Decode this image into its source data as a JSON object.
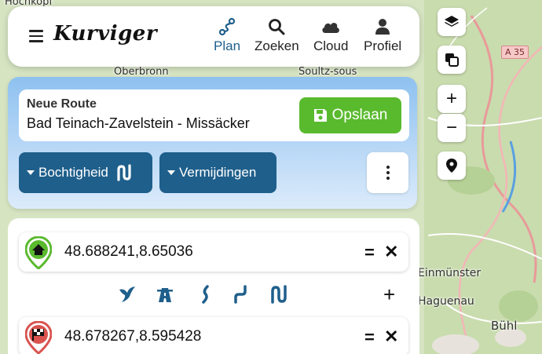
{
  "app": {
    "logo_text": "Kurviger"
  },
  "nav": [
    {
      "label": "Plan",
      "icon": "route-icon",
      "active": true
    },
    {
      "label": "Zoeken",
      "icon": "search-icon",
      "active": false
    },
    {
      "label": "Cloud",
      "icon": "cloud-icon",
      "active": false
    },
    {
      "label": "Profiel",
      "icon": "user-icon",
      "active": false
    }
  ],
  "route": {
    "caption": "Neue Route",
    "name": "Bad Teinach-Zavelstein - Missäcker",
    "save_label": "Opslaan"
  },
  "options": {
    "curviness_label": "Bochtigheid",
    "avoid_label": "Vermijdingen"
  },
  "waypoints": [
    {
      "coord": "48.688241,8.65036",
      "type": "start",
      "icon": "home-icon"
    },
    {
      "coord": "48.678267,8.595428",
      "type": "finish",
      "icon": "flag-icon"
    }
  ],
  "route_type_icons": [
    "bird-icon",
    "highway-icon",
    "curvy-icon",
    "curvier-icon",
    "curviest-icon"
  ],
  "add_label": "+",
  "map": {
    "labels": [
      "Hochkopf",
      "Oberbronn",
      "Soultz-sous",
      "Einmünster",
      "Haguenau",
      "Bühl"
    ],
    "road_shield": "A 35"
  },
  "map_controls": {
    "zoom_in": "+",
    "zoom_out": "−"
  },
  "colors": {
    "primary": "#1f5f8b",
    "save_green": "#5aba2e",
    "start_green": "#5aba2e",
    "finish_red": "#d9534f"
  }
}
